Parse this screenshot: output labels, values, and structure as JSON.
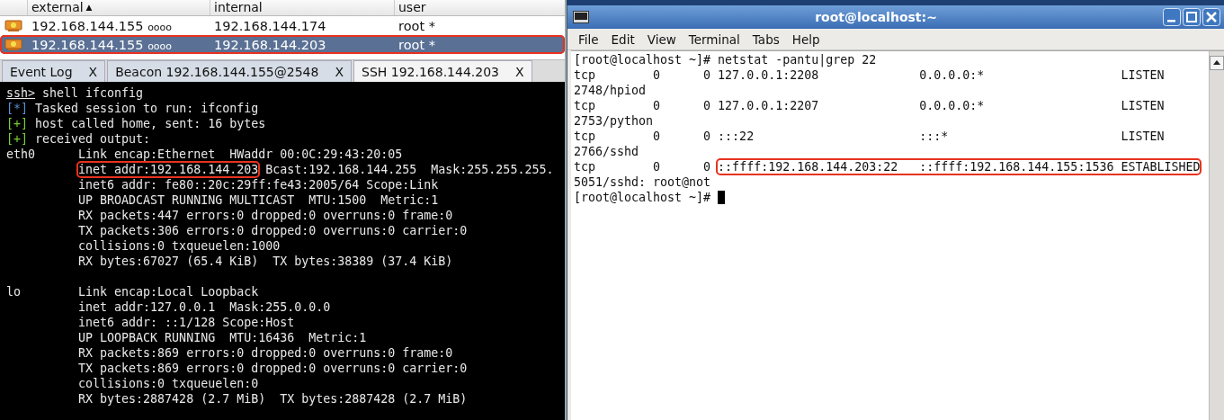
{
  "sessions": {
    "columns": [
      {
        "label": "external",
        "sort": "▲"
      },
      {
        "label": "internal"
      },
      {
        "label": "user"
      }
    ],
    "rows": [
      {
        "external": "192.168.144.155",
        "ping": "oooo",
        "internal": "192.168.144.174",
        "user": "root *",
        "selected": false,
        "highlighted": false
      },
      {
        "external": "192.168.144.155",
        "ping": "oooo",
        "internal": "192.168.144.203",
        "user": "root *",
        "selected": true,
        "highlighted": true
      }
    ]
  },
  "tabs": [
    {
      "label": "Event Log",
      "close": "X",
      "selected": false
    },
    {
      "label": "Beacon 192.168.144.155@2548",
      "close": "X",
      "selected": false
    },
    {
      "label": "SSH 192.168.144.203",
      "close": "X",
      "selected": true
    }
  ],
  "console": [
    {
      "kind": "prompt",
      "prompt": "ssh>",
      "command": " shell ifconfig"
    },
    {
      "kind": "info",
      "marker": "[*]",
      "text": " Tasked session to run: ifconfig"
    },
    {
      "kind": "success",
      "marker": "[+]",
      "text": " host called home, sent: 16 bytes"
    },
    {
      "kind": "success",
      "marker": "[+]",
      "text": " received output:"
    },
    {
      "kind": "output",
      "label": "eth0",
      "parts": [
        {
          "text": "Link encap:Ethernet  HWaddr 00:0C:29:43:20:05",
          "highlighted": false
        }
      ]
    },
    {
      "kind": "output",
      "parts": [
        {
          "text": "inet addr:192.168.144.203",
          "highlighted": true
        },
        {
          "text": " Bcast:192.168.144.255  Mask:255.255.255.",
          "highlighted": false
        }
      ]
    },
    {
      "kind": "output",
      "parts": [
        {
          "text": "inet6 addr: fe80::20c:29ff:fe43:2005/64 Scope:Link",
          "highlighted": false
        }
      ]
    },
    {
      "kind": "output",
      "parts": [
        {
          "text": "UP BROADCAST RUNNING MULTICAST  MTU:1500  Metric:1",
          "highlighted": false
        }
      ]
    },
    {
      "kind": "output",
      "parts": [
        {
          "text": "RX packets:447 errors:0 dropped:0 overruns:0 frame:0",
          "highlighted": false
        }
      ]
    },
    {
      "kind": "output",
      "parts": [
        {
          "text": "TX packets:306 errors:0 dropped:0 overruns:0 carrier:0",
          "highlighted": false
        }
      ]
    },
    {
      "kind": "output",
      "parts": [
        {
          "text": "collisions:0 txqueuelen:1000",
          "highlighted": false
        }
      ]
    },
    {
      "kind": "output",
      "parts": [
        {
          "text": "RX bytes:67027 (65.4 KiB)  TX bytes:38389 (37.4 KiB)",
          "highlighted": false
        }
      ]
    },
    {
      "kind": "blank"
    },
    {
      "kind": "output",
      "label": "lo",
      "parts": [
        {
          "text": "Link encap:Local Loopback",
          "highlighted": false
        }
      ]
    },
    {
      "kind": "output",
      "parts": [
        {
          "text": "inet addr:127.0.0.1  Mask:255.0.0.0",
          "highlighted": false
        }
      ]
    },
    {
      "kind": "output",
      "parts": [
        {
          "text": "inet6 addr: ::1/128 Scope:Host",
          "highlighted": false
        }
      ]
    },
    {
      "kind": "output",
      "parts": [
        {
          "text": "UP LOOPBACK RUNNING  MTU:16436  Metric:1",
          "highlighted": false
        }
      ]
    },
    {
      "kind": "output",
      "parts": [
        {
          "text": "RX packets:869 errors:0 dropped:0 overruns:0 frame:0",
          "highlighted": false
        }
      ]
    },
    {
      "kind": "output",
      "parts": [
        {
          "text": "TX packets:869 errors:0 dropped:0 overruns:0 carrier:0",
          "highlighted": false
        }
      ]
    },
    {
      "kind": "output",
      "parts": [
        {
          "text": "collisions:0 txqueuelen:0",
          "highlighted": false
        }
      ]
    },
    {
      "kind": "output",
      "parts": [
        {
          "text": "RX bytes:2887428 (2.7 MiB)  TX bytes:2887428 (2.7 MiB)",
          "highlighted": false
        }
      ]
    }
  ],
  "window": {
    "title": "root@localhost:~",
    "menu": [
      "File",
      "Edit",
      "View",
      "Terminal",
      "Tabs",
      "Help"
    ],
    "terminal": [
      {
        "parts": [
          {
            "text": "[root@localhost ~]# netstat -pantu|grep 22",
            "highlighted": false
          }
        ]
      },
      {
        "parts": [
          {
            "text": "tcp        0      0 127.0.0.1:2208              0.0.0.0:*                   LISTEN",
            "highlighted": false
          }
        ]
      },
      {
        "parts": [
          {
            "text": "2748/hpiod",
            "highlighted": false
          }
        ]
      },
      {
        "parts": [
          {
            "text": "tcp        0      0 127.0.0.1:2207              0.0.0.0:*                   LISTEN",
            "highlighted": false
          }
        ]
      },
      {
        "parts": [
          {
            "text": "2753/python",
            "highlighted": false
          }
        ]
      },
      {
        "parts": [
          {
            "text": "tcp        0      0 :::22                       :::*                        LISTEN",
            "highlighted": false
          }
        ]
      },
      {
        "parts": [
          {
            "text": "2766/sshd",
            "highlighted": false
          }
        ]
      },
      {
        "parts": [
          {
            "text": "tcp        0      0 ",
            "highlighted": false
          },
          {
            "text": "::ffff:192.168.144.203:22   ::ffff:192.168.144.155:1536 ESTABLISHED",
            "highlighted": true
          }
        ]
      },
      {
        "parts": [
          {
            "text": "5051/sshd: root@not",
            "highlighted": false
          }
        ]
      },
      {
        "parts": [
          {
            "text": "[root@localhost ~]# ",
            "highlighted": false
          }
        ],
        "cursor": true
      }
    ]
  }
}
